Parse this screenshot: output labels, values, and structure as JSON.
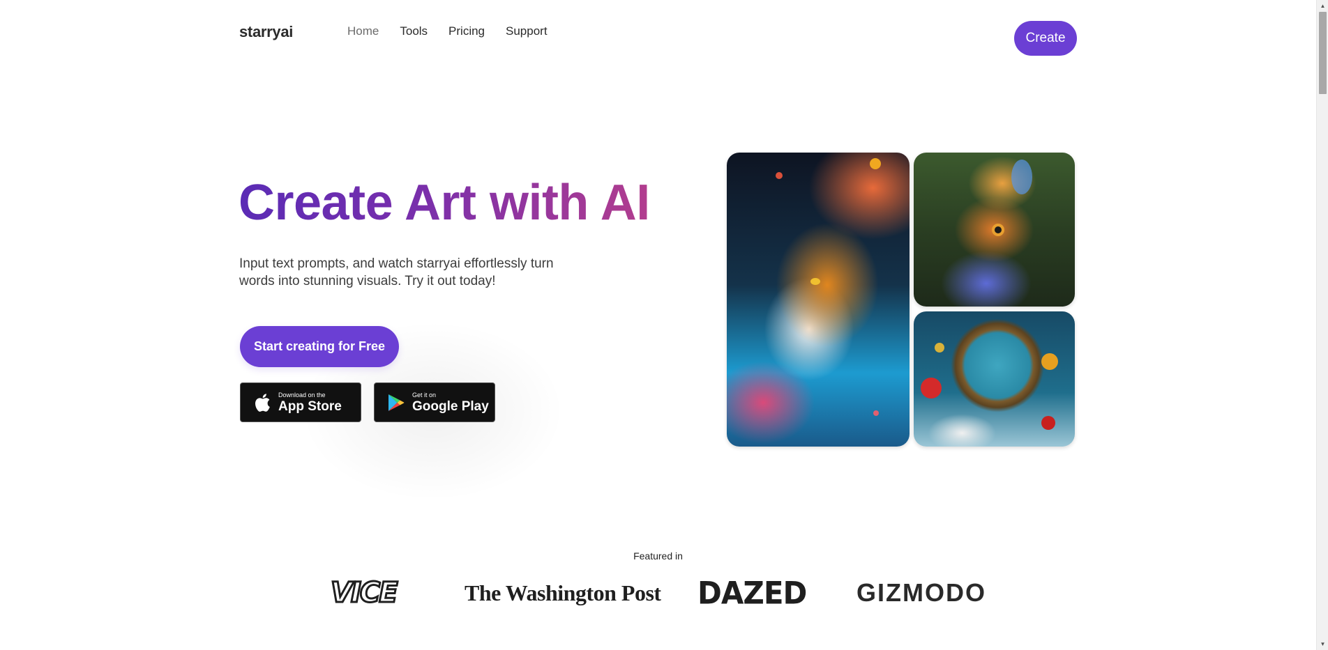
{
  "header": {
    "logo": "starryai",
    "nav": [
      {
        "label": "Home"
      },
      {
        "label": "Tools"
      },
      {
        "label": "Pricing"
      },
      {
        "label": "Support"
      }
    ],
    "create_label": "Create"
  },
  "hero": {
    "headline": "Create Art with AI",
    "subtext": "Input text prompts, and watch starryai effortlessly turn words into stunning visuals. Try it out today!",
    "cta_label": "Start creating for Free",
    "app_store": {
      "small": "Download on the",
      "big": "App Store"
    },
    "google_play": {
      "small": "Get it on",
      "big": "Google Play"
    },
    "accent_color": "#6b3fd4"
  },
  "gallery": {
    "images": [
      "tiger-artwork",
      "bird-artwork",
      "clock-artwork"
    ]
  },
  "featured": {
    "label": "Featured in",
    "logos": [
      "VICE",
      "The Washington Post",
      "DAZED",
      "GIZMODO"
    ]
  }
}
